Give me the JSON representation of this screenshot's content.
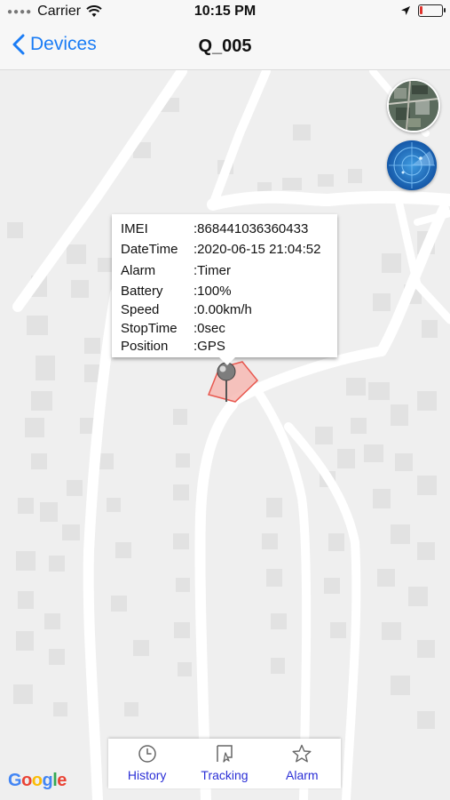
{
  "status_bar": {
    "carrier": "Carrier",
    "time": "10:15 PM"
  },
  "nav": {
    "back_label": "Devices",
    "title": "Q_005"
  },
  "popup": {
    "rows": [
      {
        "label": "IMEI",
        "value": ":868441036360433"
      },
      {
        "label": "DateTime",
        "value": ":2020-06-15 21:04:52"
      },
      {
        "label": "Alarm",
        "value": ":Timer"
      },
      {
        "label": "Battery",
        "value": ":100%"
      },
      {
        "label": "Speed",
        "value": ":0.00km/h"
      },
      {
        "label": "StopTime",
        "value": ":0sec"
      },
      {
        "label": "Position",
        "value": ":GPS"
      }
    ]
  },
  "tabs": [
    {
      "label": "History",
      "icon": "clock-icon"
    },
    {
      "label": "Tracking",
      "icon": "tracking-icon"
    },
    {
      "label": "Alarm",
      "icon": "star-icon"
    }
  ],
  "map": {
    "attribution": "Google",
    "geofence_color": "#e8584f"
  },
  "colors": {
    "accent": "#1a7cf5",
    "tab_text": "#2b2fd6"
  }
}
